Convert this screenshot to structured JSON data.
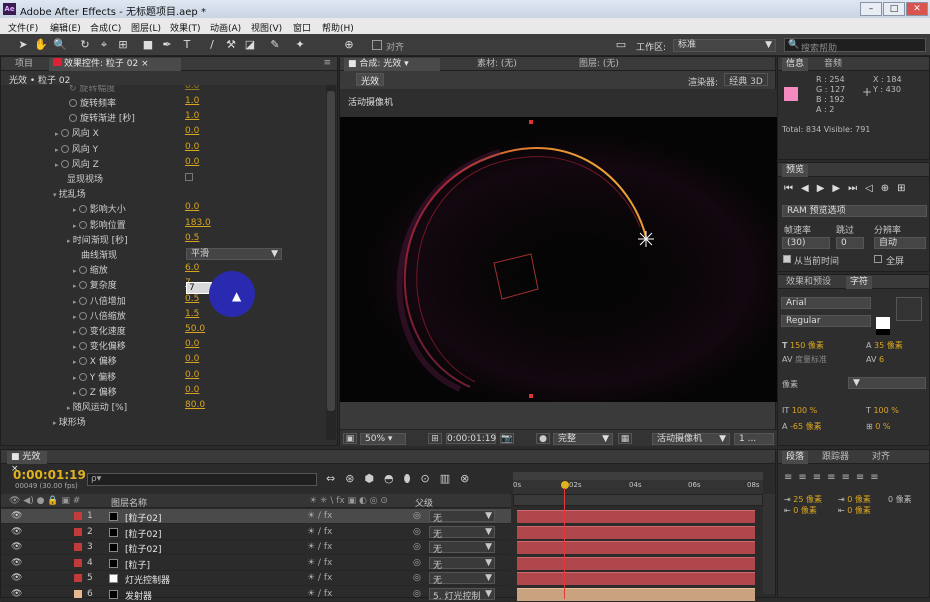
{
  "window": {
    "title": "Adobe After Effects - 无标题项目.aep *",
    "logo": "Ae",
    "min": "–",
    "max": "□",
    "close": "✕"
  },
  "menu": [
    "文件(F)",
    "编辑(E)",
    "合成(C)",
    "图层(L)",
    "效果(T)",
    "动画(A)",
    "视图(V)",
    "窗口",
    "帮助(H)"
  ],
  "toolbar": {
    "snap_label": "对齐",
    "workspace_label": "工作区:",
    "workspace_value": "标准",
    "search_placeholder": "搜索帮助"
  },
  "project_panel": {
    "tab_project": "项目",
    "tab_effects": "效果控件: 粒子 02",
    "breadcrumb": "光效 • 粒子 02"
  },
  "effects": [
    {
      "label": "旋转频率",
      "value": "1.0",
      "indent": 68,
      "sw": true
    },
    {
      "label": "旋转渐进 [秒]",
      "value": "1.0",
      "indent": 68,
      "sw": true
    },
    {
      "label": "风向 X",
      "value": "0.0",
      "indent": 68,
      "sw": true,
      "arrow": true
    },
    {
      "label": "风向 Y",
      "value": "0.0",
      "indent": 68,
      "sw": true,
      "arrow": true
    },
    {
      "label": "风向 Z",
      "value": "0.0",
      "indent": 68,
      "sw": true,
      "arrow": true
    },
    {
      "label": "显现视场",
      "value": "",
      "indent": 66,
      "sw": false
    },
    {
      "label": "扰乱场",
      "value": "",
      "indent": 66,
      "sw": false,
      "open": true
    },
    {
      "label": "影响大小",
      "value": "0.0",
      "indent": 86,
      "sw": true,
      "arrow": true
    },
    {
      "label": "影响位置",
      "value": "183.0",
      "indent": 86,
      "sw": true,
      "arrow": true
    },
    {
      "label": "时间渐现 [秒]",
      "value": "0.5",
      "indent": 80,
      "sw": false,
      "arrow": true
    },
    {
      "label": "曲线渐现",
      "value": "",
      "indent": 80,
      "sw": false
    },
    {
      "label": "缩放",
      "value": "6.0",
      "indent": 86,
      "sw": true,
      "arrow": true
    },
    {
      "label": "复杂度",
      "value": "7",
      "indent": 86,
      "sw": true,
      "arrow": true
    },
    {
      "label": "八倍增加",
      "value": "0.5",
      "indent": 86,
      "sw": true,
      "arrow": true
    },
    {
      "label": "八倍缩放",
      "value": "1.5",
      "indent": 86,
      "sw": true,
      "arrow": true
    },
    {
      "label": "变化速度",
      "value": "50.0",
      "indent": 86,
      "sw": true,
      "arrow": true
    },
    {
      "label": "变化偏移",
      "value": "0.0",
      "indent": 86,
      "sw": true,
      "arrow": true
    },
    {
      "label": "X 偏移",
      "value": "0.0",
      "indent": 86,
      "sw": true,
      "arrow": true
    },
    {
      "label": "Y 偏移",
      "value": "0.0",
      "indent": 86,
      "sw": true,
      "arrow": true
    },
    {
      "label": "Z 偏移",
      "value": "0.0",
      "indent": 86,
      "sw": true,
      "arrow": true
    },
    {
      "label": "随风运动 [%]",
      "value": "80.0",
      "indent": 80,
      "sw": false,
      "arrow": true
    },
    {
      "label": "球形场",
      "value": "",
      "indent": 66,
      "sw": false,
      "arrow": true
    }
  ],
  "curve_dropdown": "平滑",
  "composition": {
    "tab_label": "合成: 光效",
    "footage_label": "素材: (无)",
    "layer_label": "图层: (无)",
    "comp_button": "光效",
    "renderer_label": "渲染器:",
    "renderer_value": "经典 3D",
    "camera_label": "活动摄像机",
    "zoom": "50%",
    "timecode": "0:00:01:19",
    "resolution": "完整",
    "view": "活动摄像机",
    "views": "1 ..."
  },
  "info": {
    "tab_info": "信息",
    "tab_audio": "音频",
    "r": "R : 254",
    "g": "G : 127",
    "b": "B : 192",
    "a": "A : 2",
    "x": "X : 184",
    "y": "Y : 430",
    "total": "Total: 834  Visible: 791",
    "color_swatch": "#f58ac0"
  },
  "preview": {
    "tab": "预览",
    "ram_label": "RAM 预览选项",
    "frame_rate_label": "帧速率",
    "skip_label": "跳过",
    "resolution_label": "分辨率",
    "frame_rate": "(30)",
    "skip": "0",
    "resolution": "自动",
    "from_current": "从当前时间",
    "fullscreen": "全屏"
  },
  "effects_presets": {
    "tab": "效果和预设",
    "tab_char": "字符"
  },
  "character": {
    "font": "Arial",
    "style": "Regular",
    "size": "150 像素",
    "leading": "35 像素",
    "kerning": "度量标准",
    "tracking": "6",
    "stroke": "像素",
    "vscale": "100 %",
    "hscale": "100 %",
    "baseline": "-65 像素",
    "tsume": "0 %"
  },
  "paragraph": {
    "tab_para": "段落",
    "tab_tracker": "跟踪器",
    "tab_align": "对齐",
    "indent1": "25 像素",
    "indent2": "0 像素",
    "indent3": "0 像素",
    "space1": "0 像素",
    "space2": "0 像素"
  },
  "timeline": {
    "tab": "光效",
    "timecode": "0:00:01:19",
    "fps": "00049 (30.00 fps)",
    "search_placeholder": "ρ▾",
    "col_name": "图层名称",
    "col_parent": "父级",
    "ruler": [
      "0s",
      "02s",
      "04s",
      "06s",
      "08s"
    ],
    "layers": [
      {
        "num": "1",
        "name": "[粒子02]",
        "parent": "无",
        "color": "#c23a3a",
        "sel": true
      },
      {
        "num": "2",
        "name": "[粒子02]",
        "parent": "无",
        "color": "#c23a3a",
        "sel": false
      },
      {
        "num": "3",
        "name": "[粒子02]",
        "parent": "无",
        "color": "#c23a3a",
        "sel": false
      },
      {
        "num": "4",
        "name": "[粒子]",
        "parent": "无",
        "color": "#c23a3a",
        "sel": false
      },
      {
        "num": "5",
        "name": "灯光控制器",
        "parent": "无",
        "color": "#c23a3a",
        "sel": false
      },
      {
        "num": "6",
        "name": "发射器",
        "parent": "5. 灯光控制",
        "color": "#e6b890",
        "sel": false
      }
    ]
  }
}
